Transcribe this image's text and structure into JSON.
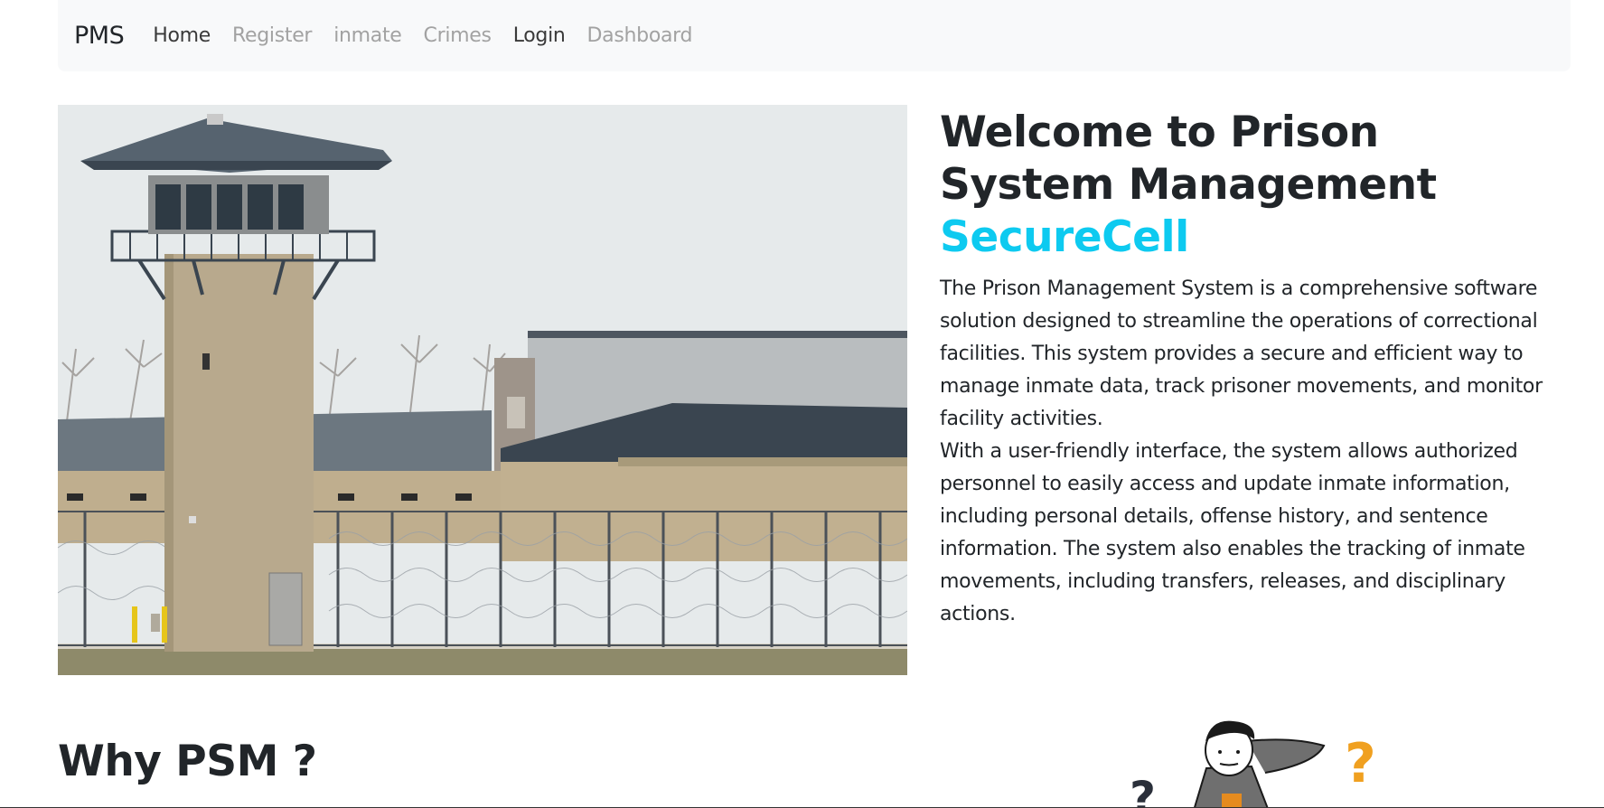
{
  "navbar": {
    "brand": "PMS",
    "links": [
      {
        "label": "Home",
        "state": "active"
      },
      {
        "label": "Register",
        "state": "muted"
      },
      {
        "label": "inmate",
        "state": "muted"
      },
      {
        "label": "Crimes",
        "state": "muted"
      },
      {
        "label": "Login",
        "state": "active"
      },
      {
        "label": "Dashboard",
        "state": "muted"
      }
    ]
  },
  "hero": {
    "title_main": "Welcome to Prison System Management ",
    "title_accent": "SecureCell",
    "paragraph1": "The Prison Management System is a comprehensive software solution designed to streamline the operations of correctional facilities. This system provides a secure and efficient way to manage inmate data, track prisoner movements, and monitor facility activities.",
    "paragraph2": "With a user-friendly interface, the system allows authorized personnel to easily access and update inmate information, including personal details, offense history, and sentence information. The system also enables the tracking of inmate movements, including transfers, releases, and disciplinary actions."
  },
  "why": {
    "title": "Why PSM ?"
  },
  "colors": {
    "accent": "#0dcaf0",
    "navbar_bg": "#f8f9fa",
    "question_mark": "#f0a020"
  }
}
